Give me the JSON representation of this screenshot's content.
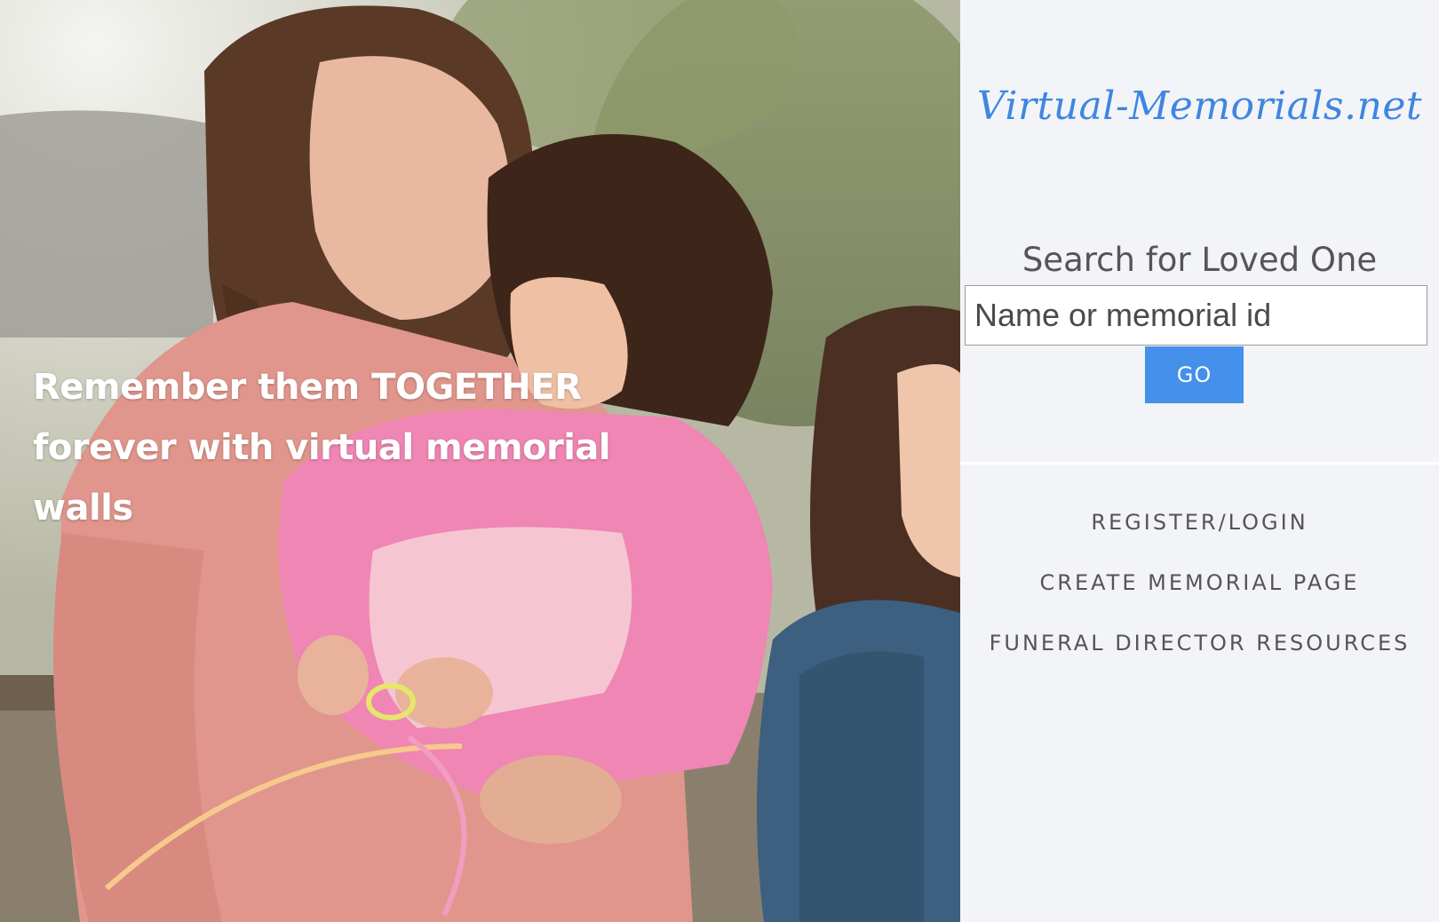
{
  "hero": {
    "tagline": "Remember them TOGETHER forever with virtual memorial walls"
  },
  "sidebar": {
    "brand": "Virtual-Memorials.net",
    "search": {
      "title": "Search for Loved One",
      "placeholder": "Name or memorial id",
      "button_label": "GO"
    },
    "nav": [
      {
        "label": "REGISTER/LOGIN"
      },
      {
        "label": "CREATE MEMORIAL PAGE"
      },
      {
        "label": "FUNERAL DIRECTOR RESOURCES"
      }
    ]
  },
  "colors": {
    "brand": "#3f86e0",
    "button": "#4490ea",
    "sidebar_bg": "#f3f4f8",
    "text_muted": "#555555"
  }
}
